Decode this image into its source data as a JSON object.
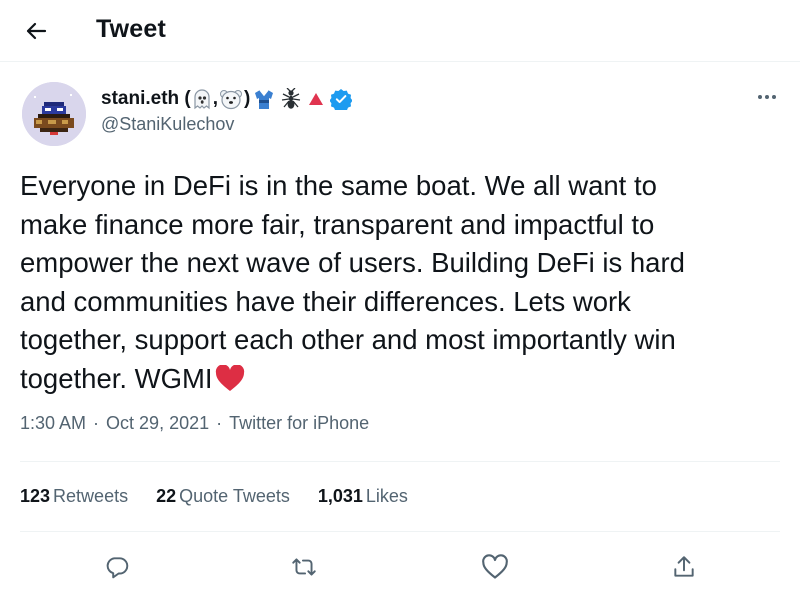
{
  "header": {
    "back_icon": "arrow-left-icon",
    "title": "Tweet"
  },
  "author": {
    "display_name": "stani.eth (",
    "display_name_suffix": ")",
    "name_emoji_icons": [
      "ghost-emoji",
      "polar-bear-emoji",
      "kimono-emoji",
      "ant-emoji",
      "triangle-emoji"
    ],
    "verified_icon": "verified-badge-icon",
    "handle": "@StaniKulechov",
    "avatar_icon": "pixel-art-avatar"
  },
  "more_icon": "more-options-icon",
  "tweet": {
    "lines": [
      "Everyone in DeFi is in the same boat. We all want to",
      "make finance more fair, transparent and impactful to",
      "empower the next wave of users. Building DeFi is hard",
      "and communities have their differences. Lets work",
      "together, support each other and most importantly win",
      "together. WGMI"
    ],
    "trailing_emoji": "red-heart-emoji"
  },
  "meta": {
    "time": "1:30 AM",
    "separator": "·",
    "date": "Oct 29, 2021",
    "source": "Twitter for iPhone"
  },
  "stats": {
    "retweets_count": "123",
    "retweets_label": "Retweets",
    "quotes_count": "22",
    "quotes_label": "Quote Tweets",
    "likes_count": "1,031",
    "likes_label": "Likes"
  },
  "actions": [
    "reply-icon",
    "retweet-icon",
    "like-icon",
    "share-icon"
  ],
  "colors": {
    "text": "#0f1419",
    "secondary": "#536471",
    "divider": "#eff3f4",
    "verified": "#1d9bf0",
    "heart": "#dd2e44"
  }
}
